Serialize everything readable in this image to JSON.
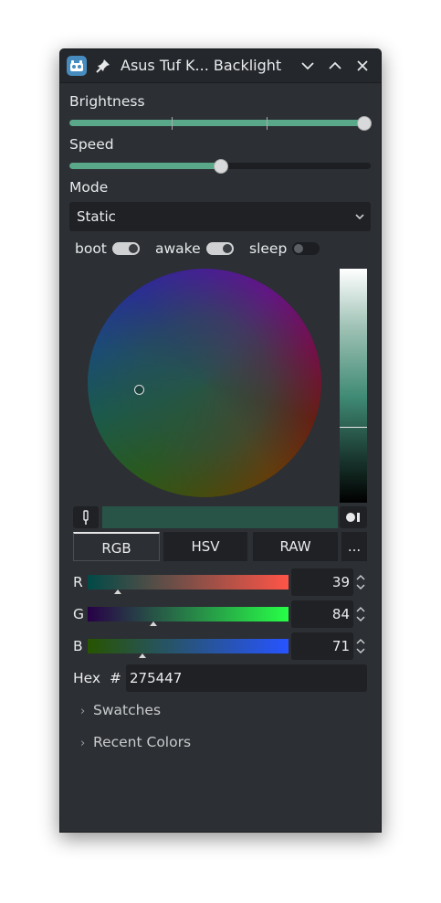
{
  "window": {
    "title": "Asus Tuf K... Backlight"
  },
  "brightness": {
    "label": "Brightness",
    "value_fraction": 1.0
  },
  "speed": {
    "label": "Speed",
    "value_fraction": 0.5
  },
  "mode": {
    "label": "Mode",
    "selected": "Static"
  },
  "toggles": [
    {
      "label": "boot",
      "on": true
    },
    {
      "label": "awake",
      "on": true
    },
    {
      "label": "sleep",
      "on": false
    }
  ],
  "color_picker": {
    "current_color": "#275447",
    "modes": [
      "RGB",
      "HSV",
      "RAW",
      "..."
    ],
    "active_mode": "RGB",
    "channels": [
      {
        "label": "R",
        "value": "39"
      },
      {
        "label": "G",
        "value": "84"
      },
      {
        "label": "B",
        "value": "71"
      }
    ],
    "hex_label": "Hex",
    "hash": "#",
    "hex_value": "275447"
  },
  "sections": {
    "swatches": "Swatches",
    "recent_colors": "Recent Colors"
  },
  "colors": {
    "accent": "#5aa88a",
    "window_bg": "#2c2f33",
    "title_bg": "#24272b",
    "field_bg": "#1f2124"
  }
}
